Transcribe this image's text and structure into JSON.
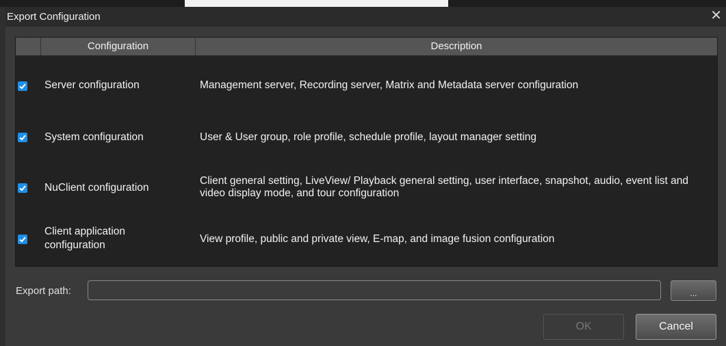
{
  "dialog": {
    "title": "Export Configuration",
    "close_glyph": "✕"
  },
  "table": {
    "headers": [
      "",
      "Configuration",
      "Description"
    ],
    "rows": [
      {
        "checked": true,
        "name": "Server configuration",
        "description": "Management server, Recording server, Matrix and Metadata server configuration"
      },
      {
        "checked": true,
        "name": "System configuration",
        "description": "User & User group, role profile, schedule profile, layout manager setting"
      },
      {
        "checked": true,
        "name": "NuClient configuration",
        "description": "Client general setting, LiveView/ Playback general setting, user interface, snapshot, audio, event list and video display mode, and tour configuration"
      },
      {
        "checked": true,
        "name": "Client application configuration",
        "description": "View profile, public and private view, E-map, and image fusion configuration"
      }
    ]
  },
  "export_path": {
    "label": "Export path:",
    "value": "",
    "browse_label": "..."
  },
  "buttons": {
    "ok_label": "OK",
    "cancel_label": "Cancel"
  },
  "colors": {
    "checkbox": "#1e8fe8",
    "dialog_bg": "#3a3a3a",
    "table_bg": "#222222",
    "header_bg": "#555555"
  }
}
